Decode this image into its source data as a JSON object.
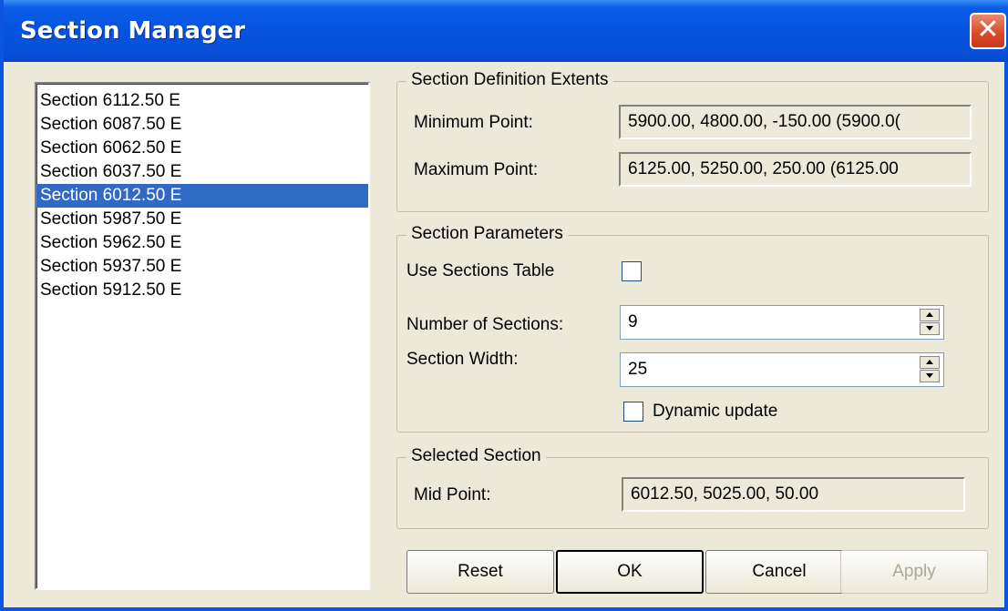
{
  "window": {
    "title": "Section Manager",
    "close_glyph": "✕"
  },
  "section_list": {
    "items": [
      "Section 6112.50 E",
      "Section 6087.50 E",
      "Section 6062.50 E",
      "Section 6037.50 E",
      "Section 6012.50 E",
      "Section 5987.50 E",
      "Section 5962.50 E",
      "Section 5937.50 E",
      "Section 5912.50 E"
    ],
    "selected": "Section 6012.50 E"
  },
  "extents": {
    "legend": "Section Definition Extents",
    "min_label": "Minimum Point:",
    "min_value": "5900.00, 4800.00, -150.00 (5900.0(",
    "max_label": "Maximum Point:",
    "max_value": "6125.00, 5250.00, 250.00 (6125.00"
  },
  "parameters": {
    "legend": "Section Parameters",
    "use_table_label": "Use Sections Table",
    "use_table_checked": false,
    "num_sections_label": "Number of Sections:",
    "num_sections_value": "9",
    "width_label": "Section Width:",
    "width_value": "25",
    "dynamic_label": "Dynamic update",
    "dynamic_checked": false
  },
  "selected_section": {
    "legend": "Selected Section",
    "mid_label": "Mid Point:",
    "mid_value": "6012.50, 5025.00, 50.00"
  },
  "buttons": {
    "reset": "Reset",
    "ok": "OK",
    "cancel": "Cancel",
    "apply": "Apply"
  },
  "colors": {
    "title_bar": "#0553e0",
    "selection": "#316ac5",
    "dialog_bg": "#ece9d8"
  }
}
